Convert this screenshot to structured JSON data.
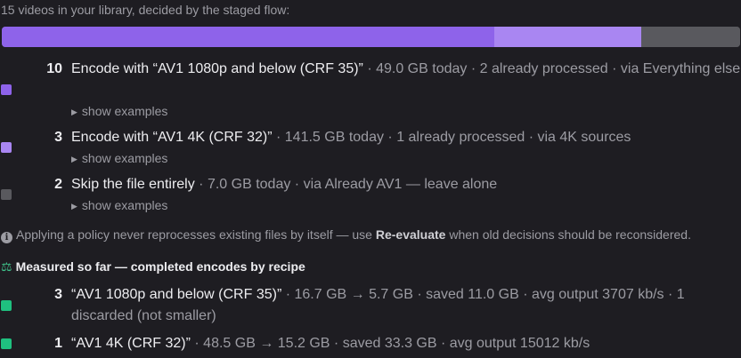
{
  "intro": "15 videos in your library, decided by the staged flow:",
  "bar": {
    "segments": [
      {
        "fraction": 0.6667,
        "color": "#8e63ea"
      },
      {
        "fraction": 0.2,
        "color": "#a986f2"
      },
      {
        "fraction": 0.1333,
        "color": "#59595e"
      }
    ]
  },
  "decisions": [
    {
      "count": "10",
      "action": "Encode with “AV1 1080p and below (CRF 35)”",
      "meta": " · 49.0 GB today · 2 already processed · via Everything else",
      "examples": "show examples",
      "color": "#8e63ea"
    },
    {
      "count": "3",
      "action": "Encode with “AV1 4K (CRF 32)”",
      "meta": " · 141.5 GB today · 1 already processed · via 4K sources",
      "examples": "show examples",
      "color": "#a986f2"
    },
    {
      "count": "2",
      "action": "Skip the file entirely",
      "meta": " · 7.0 GB today · via Already AV1 — leave alone",
      "examples": "show examples",
      "color": "#59595e"
    }
  ],
  "note": {
    "before": "Applying a policy never reprocesses existing files by itself — use ",
    "bold": "Re-evaluate",
    "after": " when old decisions should be reconsidered."
  },
  "measured": {
    "title": "Measured so far — completed encodes by recipe",
    "rows": [
      {
        "count": "3",
        "recipe": "“AV1 1080p and below (CRF 35)”",
        "meta": " · 16.7 GB → 5.7 GB · saved 11.0 GB · avg output 3707 kb/s · 1 discarded (not smaller)",
        "color": "#1fc07f"
      },
      {
        "count": "1",
        "recipe": "“AV1 4K (CRF 32)”",
        "meta": " · 48.5 GB → 15.2 GB · saved 33.3 GB · avg output 15012 kb/s",
        "color": "#1fc07f"
      }
    ]
  },
  "icons": {
    "info": "info-icon",
    "scale": "scale-icon",
    "expand": "triangle-right-icon"
  }
}
